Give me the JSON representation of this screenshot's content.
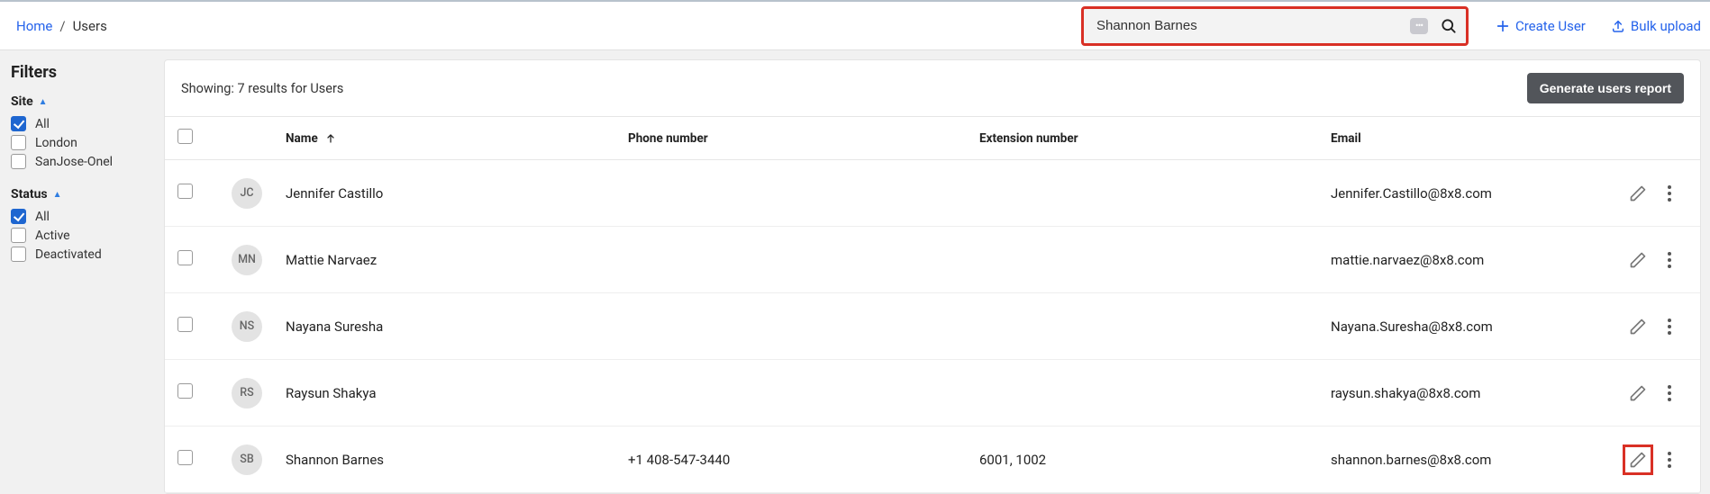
{
  "breadcrumb": {
    "home": "Home",
    "current": "Users"
  },
  "search": {
    "value": "Shannon Barnes"
  },
  "actions": {
    "create": "Create User",
    "bulk": "Bulk upload"
  },
  "filters": {
    "title": "Filters",
    "groups": [
      {
        "label": "Site",
        "options": [
          {
            "label": "All",
            "checked": true
          },
          {
            "label": "London",
            "checked": false
          },
          {
            "label": "SanJose-Onel",
            "checked": false
          }
        ]
      },
      {
        "label": "Status",
        "options": [
          {
            "label": "All",
            "checked": true
          },
          {
            "label": "Active",
            "checked": false
          },
          {
            "label": "Deactivated",
            "checked": false
          }
        ]
      }
    ]
  },
  "results": {
    "showing": "Showing: 7 results for Users",
    "report_button": "Generate users report",
    "columns": {
      "name": "Name",
      "phone": "Phone number",
      "ext": "Extension number",
      "email": "Email"
    },
    "rows": [
      {
        "initials": "JC",
        "name": "Jennifer Castillo",
        "phone": "",
        "ext": "",
        "email": "Jennifer.Castillo@8x8.com",
        "edit_hl": false
      },
      {
        "initials": "MN",
        "name": "Mattie Narvaez",
        "phone": "",
        "ext": "",
        "email": "mattie.narvaez@8x8.com",
        "edit_hl": false
      },
      {
        "initials": "NS",
        "name": "Nayana Suresha",
        "phone": "",
        "ext": "",
        "email": "Nayana.Suresha@8x8.com",
        "edit_hl": false
      },
      {
        "initials": "RS",
        "name": "Raysun Shakya",
        "phone": "",
        "ext": "",
        "email": "raysun.shakya@8x8.com",
        "edit_hl": false
      },
      {
        "initials": "SB",
        "name": "Shannon Barnes",
        "phone": "+1 408-547-3440",
        "ext": "6001, 1002",
        "email": "shannon.barnes@8x8.com",
        "edit_hl": true
      }
    ]
  }
}
